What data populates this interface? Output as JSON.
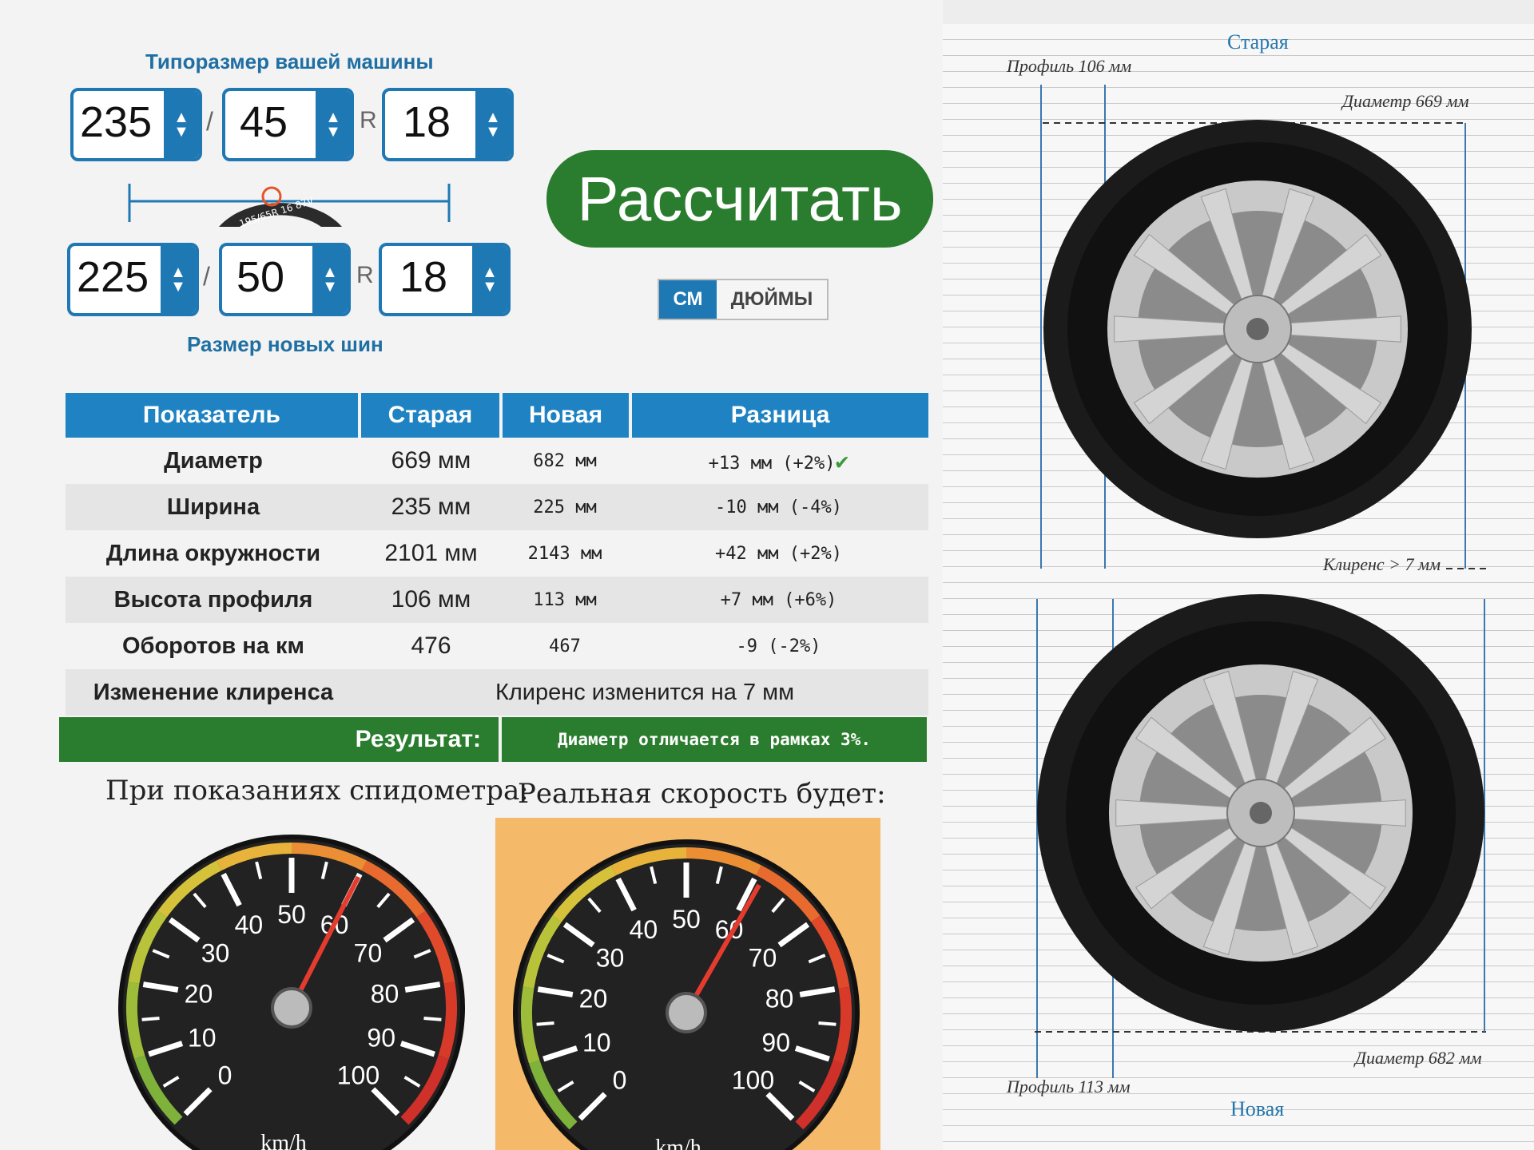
{
  "selector": {
    "current_caption": "Типоразмер вашей машины",
    "new_caption": "Размер новых шин",
    "current": {
      "width": "235",
      "profile": "45",
      "rim_prefix": "R",
      "rim": "18"
    },
    "new": {
      "width": "225",
      "profile": "50",
      "rim_prefix": "R",
      "rim": "18"
    },
    "separator": "/",
    "sample_tire_text": "195/65R 16 87V"
  },
  "calculate_label": "Рассчитать",
  "units": {
    "active": "СМ",
    "inactive": "ДЮЙМЫ"
  },
  "table": {
    "headers": [
      "Показатель",
      "Старая",
      "Новая",
      "Разница"
    ],
    "rows": [
      {
        "name": "Диаметр",
        "old": "669 мм",
        "new": "682 мм",
        "diff": "+13 мм (+2%)",
        "ok": true
      },
      {
        "name": "Ширина",
        "old": "235 мм",
        "new": "225 мм",
        "diff": "-10 мм (-4%)"
      },
      {
        "name": "Длина окружности",
        "old": "2101 мм",
        "new": "2143 мм",
        "diff": "+42 мм (+2%)"
      },
      {
        "name": "Высота профиля",
        "old": "106 мм",
        "new": "113 мм",
        "diff": "+7 мм (+6%)"
      },
      {
        "name": "Оборотов на км",
        "old": "476",
        "new": "467",
        "diff": "-9 (-2%)"
      }
    ],
    "clearance": {
      "name": "Изменение клиренса",
      "value": "Клиренс изменится на 7 мм"
    },
    "result": {
      "label": "Результат:",
      "text": "Диаметр отличается в рамках 3%."
    }
  },
  "speed": {
    "left_caption": "При показаниях спидометра:",
    "right_caption": "Реальная скорость будет:",
    "unit": "km/h",
    "ticks": [
      "0",
      "10",
      "20",
      "30",
      "40",
      "50",
      "60",
      "70",
      "80",
      "90",
      "100"
    ],
    "indicated": 60,
    "real": 61,
    "colors": {
      "real_bg": "#f5b96a",
      "needle": "#e53b2f"
    }
  },
  "diagram": {
    "old": {
      "title": "Старая",
      "profile": "Профиль 106 мм",
      "diameter": "Диаметр 669 мм",
      "clearance": "Клиренс > 7 мм"
    },
    "new": {
      "title": "Новая",
      "profile": "Профиль 113 мм",
      "diameter": "Диаметр 682 мм"
    }
  }
}
